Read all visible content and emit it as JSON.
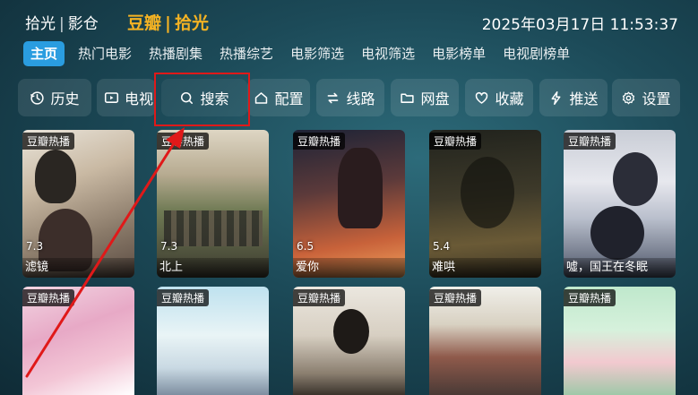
{
  "header": {
    "app_name": "拾光",
    "app_sub": "影仓",
    "source_name": "豆瓣",
    "source_sub": "拾光",
    "datetime": "2025年03月17日 11:53:37"
  },
  "nav": {
    "tabs": [
      "主页",
      "热门电影",
      "热播剧集",
      "热播综艺",
      "电影筛选",
      "电视筛选",
      "电影榜单",
      "电视剧榜单"
    ],
    "active": "主页"
  },
  "toolbar": {
    "history": "历史",
    "tv": "电视",
    "search": "搜索",
    "config": "配置",
    "route": "线路",
    "netdisk": "网盘",
    "favorites": "收藏",
    "push": "推送",
    "settings": "设置"
  },
  "cards_row1": [
    {
      "badge": "豆瓣热播",
      "score": "7.3",
      "title": "滤镜"
    },
    {
      "badge": "豆瓣热播",
      "score": "7.3",
      "title": "北上"
    },
    {
      "badge": "豆瓣热播",
      "score": "6.5",
      "title": "爱你"
    },
    {
      "badge": "豆瓣热播",
      "score": "5.4",
      "title": "难哄"
    },
    {
      "badge": "豆瓣热播",
      "score": "",
      "title": "噓，国王在冬眠"
    }
  ],
  "cards_row2": [
    {
      "badge": "豆瓣热播"
    },
    {
      "badge": "豆瓣热播"
    },
    {
      "badge": "豆瓣热播"
    },
    {
      "badge": "豆瓣热播"
    },
    {
      "badge": "豆瓣热播"
    }
  ],
  "colors": {
    "accent_tab": "#2a9de0",
    "brand_gold": "#f5b323",
    "highlight_red": "#e01919"
  }
}
